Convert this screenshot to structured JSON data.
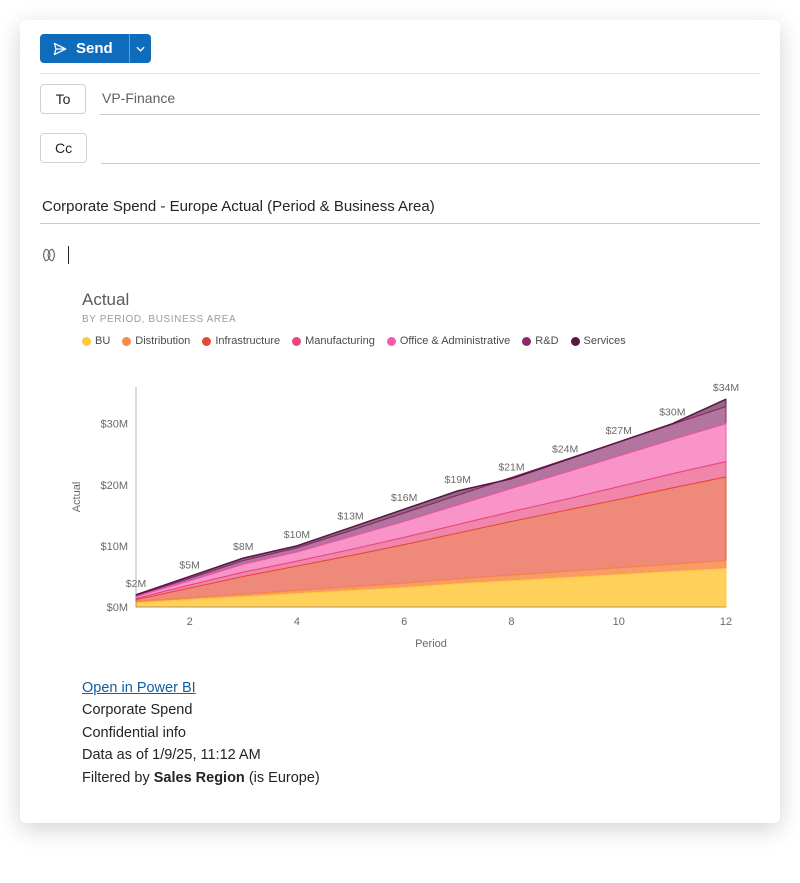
{
  "toolbar": {
    "send_label": "Send"
  },
  "addresses": {
    "to_label": "To",
    "to_value": "VP-Finance",
    "cc_label": "Cc",
    "cc_value": ""
  },
  "subject": "Corporate Spend - Europe Actual (Period & Business Area)",
  "chart_data": {
    "type": "area",
    "title": "Actual",
    "subtitle": "BY PERIOD, BUSINESS AREA",
    "xlabel": "Period",
    "ylabel": "Actual",
    "x": [
      1,
      2,
      3,
      4,
      5,
      6,
      7,
      8,
      9,
      10,
      11,
      12
    ],
    "x_ticks": [
      2,
      4,
      6,
      8,
      10,
      12
    ],
    "y_ticks": [
      0,
      10,
      20,
      30
    ],
    "y_tick_labels": [
      "$0M",
      "$10M",
      "$20M",
      "$30M"
    ],
    "ylim": [
      0,
      36
    ],
    "series": [
      {
        "name": "BU",
        "color": "#ffc83d",
        "values": [
          0.7,
          1.2,
          1.7,
          2.2,
          2.7,
          3.2,
          3.8,
          4.3,
          4.8,
          5.3,
          5.8,
          6.3
        ]
      },
      {
        "name": "Distribution",
        "color": "#f7894a",
        "values": [
          0.9,
          1.5,
          2.1,
          2.7,
          3.3,
          3.9,
          4.6,
          5.2,
          5.8,
          6.4,
          7.0,
          7.6
        ]
      },
      {
        "name": "Infrastructure",
        "color": "#e74a32",
        "values": [
          1.2,
          3.1,
          5.0,
          6.7,
          8.4,
          10.2,
          12.1,
          14.0,
          15.8,
          17.6,
          19.5,
          21.3
        ]
      },
      {
        "name": "Manufacturing",
        "color": "#e8467c",
        "values": [
          1.4,
          3.6,
          5.7,
          7.5,
          9.4,
          11.4,
          13.5,
          15.6,
          17.6,
          19.7,
          21.8,
          23.8
        ]
      },
      {
        "name": "Office & Administrative",
        "color": "#f65aab",
        "values": [
          1.7,
          4.3,
          7.0,
          9.0,
          11.5,
          14.0,
          16.7,
          19.4,
          22.0,
          24.7,
          27.4,
          30.0
        ]
      },
      {
        "name": "R&D",
        "color": "#8a2a6b",
        "values": [
          1.9,
          4.7,
          7.6,
          9.7,
          12.5,
          15.4,
          18.3,
          21.2,
          24.1,
          27.0,
          29.9,
          32.8
        ]
      },
      {
        "name": "Services",
        "color": "#5a1743",
        "values": [
          2.0,
          5.0,
          8.0,
          10.0,
          13.0,
          16.0,
          19.0,
          21.0,
          24.0,
          27.0,
          30.0,
          34.0
        ]
      }
    ],
    "data_labels": [
      "$2M",
      "$5M",
      "$8M",
      "$10M",
      "$13M",
      "$16M",
      "$19M",
      "$21M",
      "$24M",
      "$27M",
      "$30M",
      "$34M"
    ]
  },
  "footer": {
    "open_link": "Open in Power BI",
    "report_name": "Corporate Spend",
    "confidential": "Confidential info",
    "data_asof_prefix": "Data as of ",
    "data_asof_value": "1/9/25, 11:12 AM",
    "filter_prefix": "Filtered by ",
    "filter_field": "Sales Region",
    "filter_suffix": " (is Europe)"
  }
}
